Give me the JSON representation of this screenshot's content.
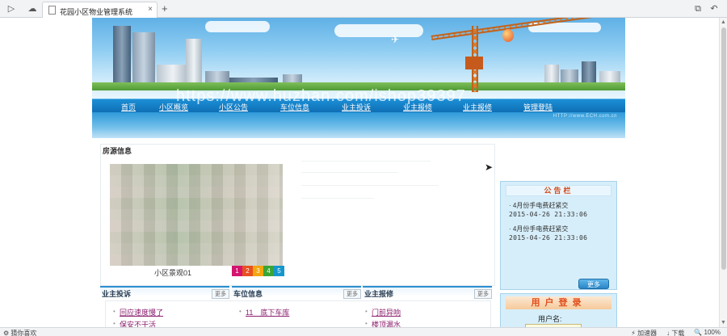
{
  "browser": {
    "tab_title": "花园小区物业管理系统",
    "tab_close": "×",
    "new_tab": "+",
    "btn_sidebar": "▷",
    "btn_cloud": "☁",
    "btn_tabs": "⧉",
    "btn_undo": "↶",
    "scroll_up": "▲",
    "scroll_down": "▼"
  },
  "site": {
    "nav": [
      "首页",
      "小区概览",
      "小区公告",
      "车位信息",
      "业主投诉",
      "业主报修",
      "业主报修",
      "管理登陆"
    ],
    "nav_sub_url": "HTTP://www.ECH.com.cn",
    "watermark": "https://www.huzhan.com/ishop39397"
  },
  "main": {
    "panel_title": "房源信息",
    "photo_caption": "小区景观01",
    "pager": [
      "1",
      "2",
      "3",
      "4",
      "5"
    ],
    "pager_colors": [
      "#d3146f",
      "#e8501f",
      "#f2a60f",
      "#3aa535",
      "#1597cc"
    ]
  },
  "columns": [
    {
      "title": "业主投诉",
      "more": "更多",
      "items": [
        "回应速度慢了",
        "保安不干活"
      ]
    },
    {
      "title": "车位信息",
      "more": "更多",
      "items": [
        "11　底下车库"
      ]
    },
    {
      "title": "业主报修",
      "more": "更多",
      "items": [
        "门前异响",
        "楼顶漏水"
      ]
    }
  ],
  "sidebar": {
    "notice_title": "公告栏",
    "notices": [
      {
        "text": "4月份手电费赶紧交",
        "date": "2015-04-26 21:33:06"
      },
      {
        "text": "4月份手电费赶紧交",
        "date": "2015-04-26 21:33:06"
      }
    ],
    "more_button": "更多",
    "login_title": "用户登录",
    "username_label": "用户名:"
  },
  "statusbar": {
    "left": "猜你喜欢",
    "right": [
      "加速器",
      "下载",
      "100%"
    ]
  }
}
